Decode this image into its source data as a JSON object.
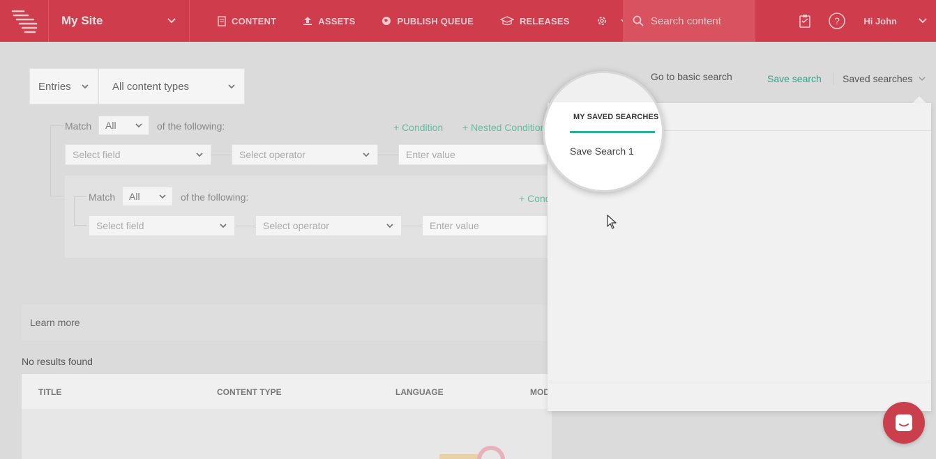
{
  "topbar": {
    "site_name": "My Site",
    "nav": [
      {
        "label": "CONTENT",
        "icon": "document-icon"
      },
      {
        "label": "ASSETS",
        "icon": "upload-icon"
      },
      {
        "label": "PUBLISH QUEUE",
        "icon": "globe-icon"
      },
      {
        "label": "RELEASES",
        "icon": "releases-icon"
      }
    ],
    "search_placeholder": "Search content",
    "greeting": "Hi John",
    "accent_color": "#cf3c4b"
  },
  "search": {
    "entries_label": "Entries",
    "content_types_label": "All content types",
    "goto_basic": "Go to basic search",
    "save_search": "Save search",
    "saved_searches": "Saved searches"
  },
  "conditions": {
    "match_label": "Match",
    "match_value": "All",
    "of_following": "of the following:",
    "add_condition": "+ Condition",
    "add_nested": "+ Nested Condition",
    "select_field": "Select field",
    "select_operator": "Select operator",
    "enter_value": "Enter value",
    "nested": {
      "match_label": "Match",
      "match_value": "All",
      "of_following": "of the following:",
      "add_condition": "+ Cond",
      "select_field": "Select field",
      "select_operator": "Select operator",
      "enter_value": "Enter value"
    }
  },
  "learn_more": "Learn more",
  "results": {
    "empty": "No results found",
    "columns": [
      "TITLE",
      "CONTENT TYPE",
      "LANGUAGE",
      "MOD"
    ]
  },
  "saved_panel": {
    "tab_label": "MY SAVED SEARCHES",
    "items": [
      "Save Search 1"
    ],
    "tab_color": "#2ab193"
  }
}
